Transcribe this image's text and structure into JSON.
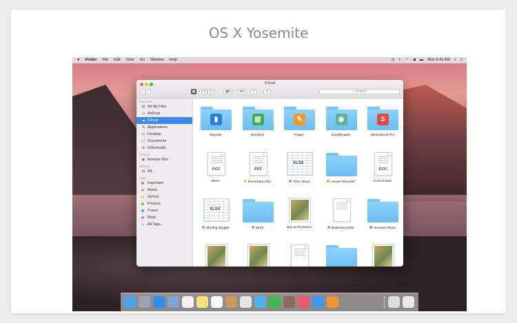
{
  "card": {
    "title": "OS X Yosemite"
  },
  "menubar": {
    "apple_icon": "apple-logo",
    "app_name": "Finder",
    "menus": [
      "File",
      "Edit",
      "View",
      "Go",
      "Window",
      "Help"
    ],
    "status_icons": [
      "time-machine-icon",
      "bluetooth-icon",
      "wifi-icon",
      "volume-icon",
      "battery-icon"
    ],
    "clock": "Mon 9:41 AM",
    "right_icons": [
      "spotlight-icon",
      "notification-center-icon"
    ]
  },
  "finder": {
    "title": "iCloud",
    "search_placeholder": "Search",
    "sidebar": {
      "favorites_header": "Favorites",
      "favorites": [
        {
          "label": "All My Files",
          "icon": "all-files-icon"
        },
        {
          "label": "AirDrop",
          "icon": "airdrop-icon"
        },
        {
          "label": "iCloud",
          "icon": "cloud-icon",
          "selected": true
        },
        {
          "label": "Applications",
          "icon": "applications-icon"
        },
        {
          "label": "Desktop",
          "icon": "desktop-icon"
        },
        {
          "label": "Documents",
          "icon": "documents-icon"
        },
        {
          "label": "Downloads",
          "icon": "downloads-icon"
        }
      ],
      "devices_header": "Devices",
      "devices": [
        {
          "label": "Remote Disc",
          "icon": "disc-icon"
        }
      ],
      "shared_header": "Shared",
      "shared": [
        {
          "label": "All...",
          "icon": "network-icon"
        }
      ],
      "tags_header": "Tags",
      "tags": [
        {
          "label": "Important",
          "color": "#fb5c5c"
        },
        {
          "label": "Home",
          "color": "#f79b32"
        },
        {
          "label": "School",
          "color": "#f5cf3c"
        },
        {
          "label": "Finance",
          "color": "#62c85a"
        },
        {
          "label": "Travel",
          "color": "#4a9ef5"
        },
        {
          "label": "Work",
          "color": "#c27ae3"
        },
        {
          "label": "All Tags...",
          "color": "#cfcfcf"
        }
      ]
    },
    "items": [
      {
        "label": "Keynote",
        "kind": "folder",
        "badge": "keynote-app-icon",
        "badge_color": "#2b7dd8",
        "glyph": "▮"
      },
      {
        "label": "Numbers",
        "kind": "folder",
        "badge": "numbers-app-icon",
        "badge_color": "#3cae4b",
        "glyph": "▥"
      },
      {
        "label": "Pages",
        "kind": "folder",
        "badge": "pages-app-icon",
        "badge_color": "#f19a2c",
        "glyph": "✎"
      },
      {
        "label": "GoodReader",
        "kind": "folder",
        "badge": "goodreader-app-icon",
        "badge_color": "#59b49a",
        "glyph": "◉"
      },
      {
        "label": "SketchBook Pro",
        "kind": "folder",
        "badge": "sketchbook-app-icon",
        "badge_color": "#e4473c",
        "glyph": "S"
      },
      {
        "label": "Menu",
        "kind": "doc",
        "ext": "DOC"
      },
      {
        "label": "Permission Slip",
        "kind": "doc",
        "ext": "PDF",
        "tag_color": "#f5cf3c"
      },
      {
        "label": "Time Sheet",
        "kind": "sheet",
        "ext": "XLSX",
        "tag_color": "#c27ae3"
      },
      {
        "label": "House Remodel",
        "kind": "folder",
        "tag_color": "#f79b32"
      },
      {
        "label": "Cover Letter",
        "kind": "doc",
        "ext": "DOC"
      },
      {
        "label": "Monthly Budget",
        "kind": "sheet",
        "ext": "XLSX",
        "tag_color": "#62c85a"
      },
      {
        "label": "Work",
        "kind": "folder",
        "tag_color": "#c27ae3"
      },
      {
        "label": "Day at the beach",
        "kind": "photo"
      },
      {
        "label": "Business Letter",
        "kind": "doc",
        "ext": "",
        "tag_color": "#c27ae3"
      },
      {
        "label": "Summer Plans",
        "kind": "folder",
        "tag_color": "#4a9ef5"
      },
      {
        "label": "",
        "kind": "photo"
      },
      {
        "label": "",
        "kind": "photo"
      },
      {
        "label": "",
        "kind": "doc",
        "ext": ""
      },
      {
        "label": "",
        "kind": "folder"
      },
      {
        "label": "",
        "kind": "photo"
      }
    ]
  },
  "dock": {
    "apps": [
      {
        "name": "finder-icon",
        "color": "#4aa3f0"
      },
      {
        "name": "launchpad-icon",
        "color": "#9aa4b2"
      },
      {
        "name": "safari-icon",
        "color": "#2f8fe8"
      },
      {
        "name": "preview-icon",
        "color": "#7da6d4"
      },
      {
        "name": "calendar-icon",
        "color": "#f2f2f2"
      },
      {
        "name": "notes-icon",
        "color": "#f6e27a"
      },
      {
        "name": "reminders-icon",
        "color": "#fafafa"
      },
      {
        "name": "contacts-icon",
        "color": "#c79b5d"
      },
      {
        "name": "photos-icon",
        "color": "#e6e6e6"
      },
      {
        "name": "messages-icon",
        "color": "#4bb4ef"
      },
      {
        "name": "facetime-icon",
        "color": "#3cba54"
      },
      {
        "name": "photo-booth-icon",
        "color": "#8b6b5a"
      },
      {
        "name": "itunes-icon",
        "color": "#f0566b"
      },
      {
        "name": "app-store-icon",
        "color": "#3b9bf0"
      },
      {
        "name": "ibooks-icon",
        "color": "#f29530"
      },
      {
        "name": "system-preferences-icon",
        "color": "#8c8c8c"
      },
      {
        "name": "documents-stack-icon",
        "color": "#dcdcdc"
      },
      {
        "name": "trash-icon",
        "color": "#e8e8e8"
      }
    ]
  }
}
